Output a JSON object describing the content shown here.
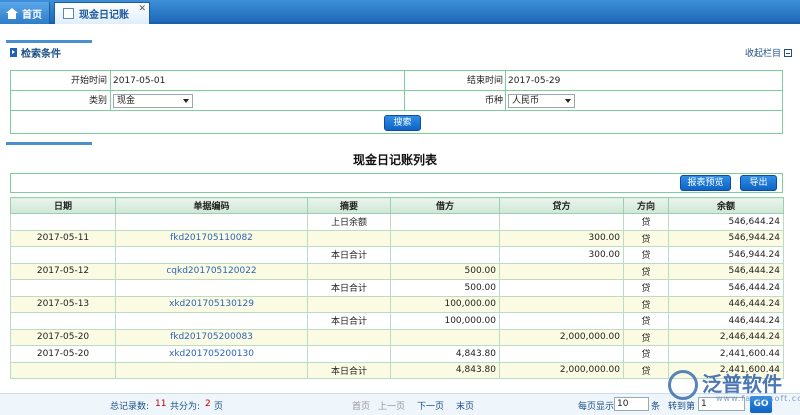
{
  "tabs": [
    {
      "label": "首页"
    },
    {
      "label": "现金日记账"
    }
  ],
  "search_section": {
    "title": "检索条件",
    "collapse_label": "收起栏目"
  },
  "search": {
    "start_label": "开始时间",
    "start_value": "2017-05-01",
    "end_label": "结束时间",
    "end_value": "2017-05-29",
    "category_label": "类别",
    "category_value": "现金",
    "currency_label": "币种",
    "currency_value": "人民币",
    "search_button": "搜索"
  },
  "report": {
    "title": "现金日记账列表",
    "preview_button": "报表预览",
    "export_button": "导出"
  },
  "table": {
    "headers": [
      "日期",
      "单据编码",
      "摘要",
      "借方",
      "贷方",
      "方向",
      "余额"
    ],
    "rows": [
      [
        "",
        "",
        "上日余额",
        "",
        "",
        "贷",
        "546,644.24"
      ],
      [
        "2017-05-11",
        "fkd201705110082",
        "",
        "",
        "300.00",
        "贷",
        "546,944.24"
      ],
      [
        "",
        "",
        "本日合计",
        "",
        "300.00",
        "贷",
        "546,944.24"
      ],
      [
        "2017-05-12",
        "cqkd201705120022",
        "",
        "500.00",
        "",
        "贷",
        "546,444.24"
      ],
      [
        "",
        "",
        "本日合计",
        "500.00",
        "",
        "贷",
        "546,444.24"
      ],
      [
        "2017-05-13",
        "xkd201705130129",
        "",
        "100,000.00",
        "",
        "贷",
        "446,444.24"
      ],
      [
        "",
        "",
        "本日合计",
        "100,000.00",
        "",
        "贷",
        "446,444.24"
      ],
      [
        "2017-05-20",
        "fkd201705200083",
        "",
        "",
        "2,000,000.00",
        "贷",
        "2,446,444.24"
      ],
      [
        "2017-05-20",
        "xkd201705200130",
        "",
        "4,843.80",
        "",
        "贷",
        "2,441,600.44"
      ],
      [
        "",
        "",
        "本日合计",
        "4,843.80",
        "2,000,000.00",
        "贷",
        "2,441,600.44"
      ]
    ]
  },
  "pager": {
    "total_label": "总记录数:",
    "total_count": "11",
    "pages_label": "共分为:",
    "pages_count": "2",
    "pages_unit": "页",
    "first": "首页",
    "prev": "上一页",
    "next": "下一页",
    "last": "末页",
    "per_page_label": "每页显示",
    "per_page_value": "10",
    "per_page_unit": "条",
    "goto_label": "转到第",
    "goto_value": "1",
    "goto_button": "GO"
  },
  "watermark": {
    "brand": "泛普软件",
    "site": "www.fanpusoft.com"
  },
  "colors": {
    "accent": "#1e69b8",
    "grid_border": "#7ccf9a",
    "row_highlight": "#fbfbe3",
    "link": "#2a63b8",
    "count": "#c00000"
  }
}
